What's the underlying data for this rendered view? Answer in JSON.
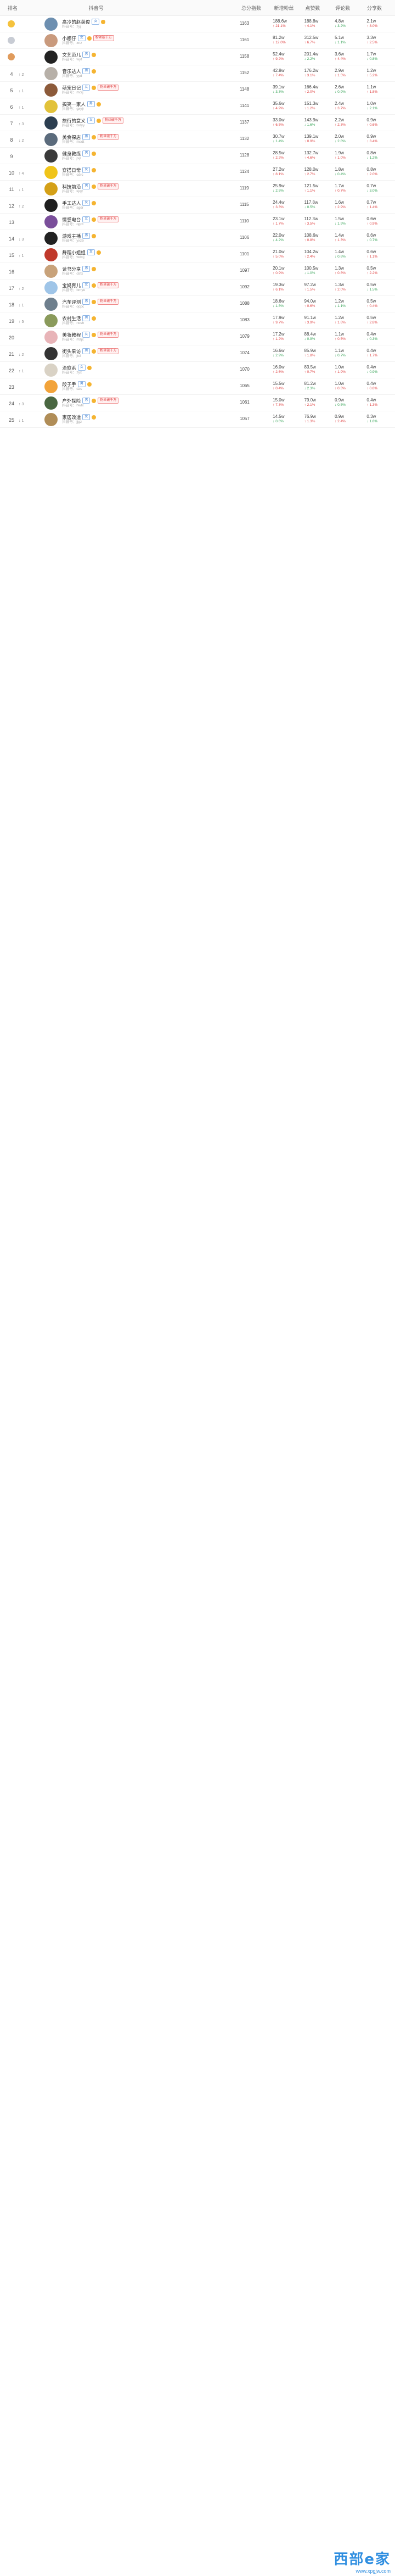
{
  "header": {
    "col_rank": "排名",
    "col_name": "抖音号",
    "col_score": "总分指数",
    "col_m1": "新增粉丝",
    "col_m2": "点赞数",
    "col_m3": "评论数",
    "col_m4": "分享数"
  },
  "colors": {
    "accent": "#e04848",
    "tag_blue": "#3f7fd1",
    "watermark": "#2f8ee0"
  },
  "watermark": {
    "title": "西部e家",
    "url": "www.xpgjw.com"
  },
  "rows": [
    {
      "rank": "1",
      "change": "",
      "name": "高冷的赵英俊",
      "sub": "抖音号：zyj",
      "tag": "女",
      "red": "",
      "score": "1163",
      "m1": "188.6w",
      "m1s": "↑ 21.1%",
      "m2": "188.8w",
      "m2s": "↑ 4.1%",
      "m3": "4.8w",
      "m3s": "↓ 3.2%",
      "m4": "2.1w",
      "m4s": "↑ 8.0%",
      "avatar": "#6d8fb0"
    },
    {
      "rank": "2",
      "change": "",
      "name": "小娜仔",
      "sub": "抖音号：xnz",
      "tag": "女",
      "red": "粉丝破千万",
      "score": "1161",
      "m1": "81.2w",
      "m1s": "↑ 12.0%",
      "m2": "312.5w",
      "m2s": "↑ 6.7%",
      "m3": "5.1w",
      "m3s": "↓ 1.1%",
      "m4": "3.3w",
      "m4s": "↑ 2.5%",
      "avatar": "#c99a7d"
    },
    {
      "rank": "3",
      "change": "",
      "name": "文艺范儿",
      "sub": "抖音号：wyf",
      "tag": "男",
      "red": "",
      "score": "1158",
      "m1": "52.4w",
      "m1s": "↑ 9.2%",
      "m2": "201.4w",
      "m2s": "↓ 2.2%",
      "m3": "3.6w",
      "m3s": "↑ 4.4%",
      "m4": "1.7w",
      "m4s": "↓ 0.8%",
      "avatar": "#222222"
    },
    {
      "rank": "4",
      "change": "↑ 2",
      "name": "音乐达人",
      "sub": "抖音号：yyd",
      "tag": "男",
      "red": "",
      "score": "1152",
      "m1": "42.8w",
      "m1s": "↑ 7.4%",
      "m2": "176.2w",
      "m2s": "↑ 3.1%",
      "m3": "2.9w",
      "m3s": "↑ 1.5%",
      "m4": "1.2w",
      "m4s": "↑ 5.2%",
      "avatar": "#b7b0a8"
    },
    {
      "rank": "5",
      "change": "↓ 1",
      "name": "萌宠日记",
      "sub": "抖音号：mcrj",
      "tag": "女",
      "red": "粉丝破千万",
      "score": "1148",
      "m1": "39.1w",
      "m1s": "↓ 3.3%",
      "m2": "166.4w",
      "m2s": "↑ 2.0%",
      "m3": "2.6w",
      "m3s": "↓ 0.9%",
      "m4": "1.1w",
      "m4s": "↑ 1.8%",
      "avatar": "#8c5a3a"
    },
    {
      "rank": "6",
      "change": "↑ 1",
      "name": "搞笑一家人",
      "sub": "抖音号：gxyjr",
      "tag": "男",
      "red": "",
      "score": "1141",
      "m1": "35.6w",
      "m1s": "↑ 4.9%",
      "m2": "151.3w",
      "m2s": "↑ 1.2%",
      "m3": "2.4w",
      "m3s": "↑ 3.7%",
      "m4": "1.0w",
      "m4s": "↓ 2.1%",
      "avatar": "#e2c23a"
    },
    {
      "rank": "7",
      "change": "↑ 3",
      "name": "旅行的意义",
      "sub": "抖音号：lxdyy",
      "tag": "女",
      "red": "粉丝破千万",
      "score": "1137",
      "m1": "33.0w",
      "m1s": "↑ 6.5%",
      "m2": "143.9w",
      "m2s": "↓ 1.6%",
      "m3": "2.2w",
      "m3s": "↑ 2.3%",
      "m4": "0.9w",
      "m4s": "↑ 0.6%",
      "avatar": "#2c3e50"
    },
    {
      "rank": "8",
      "change": "↓ 2",
      "name": "美食探店",
      "sub": "抖音号：msdt",
      "tag": "男",
      "red": "粉丝破千万",
      "score": "1132",
      "m1": "30.7w",
      "m1s": "↓ 1.4%",
      "m2": "139.1w",
      "m2s": "↑ 0.9%",
      "m3": "2.0w",
      "m3s": "↓ 2.8%",
      "m4": "0.9w",
      "m4s": "↑ 3.4%",
      "avatar": "#5b6b7c"
    },
    {
      "rank": "9",
      "change": "",
      "name": "健身教练",
      "sub": "抖音号：jsjl",
      "tag": "男",
      "red": "",
      "score": "1128",
      "m1": "28.5w",
      "m1s": "↑ 2.2%",
      "m2": "132.7w",
      "m2s": "↑ 4.6%",
      "m3": "1.9w",
      "m3s": "↑ 1.0%",
      "m4": "0.8w",
      "m4s": "↓ 1.2%",
      "avatar": "#3a3a3a"
    },
    {
      "rank": "10",
      "change": "↑ 4",
      "name": "穿搭日常",
      "sub": "抖音号：cdrc",
      "tag": "女",
      "red": "",
      "score": "1124",
      "m1": "27.2w",
      "m1s": "↑ 8.1%",
      "m2": "128.0w",
      "m2s": "↑ 2.7%",
      "m3": "1.8w",
      "m3s": "↓ 0.4%",
      "m4": "0.8w",
      "m4s": "↑ 2.0%",
      "avatar": "#f0c419"
    },
    {
      "rank": "11",
      "change": "↓ 1",
      "name": "科技前沿",
      "sub": "抖音号：kjqy",
      "tag": "男",
      "red": "粉丝破千万",
      "score": "1119",
      "m1": "25.9w",
      "m1s": "↓ 2.5%",
      "m2": "121.5w",
      "m2s": "↑ 1.1%",
      "m3": "1.7w",
      "m3s": "↑ 0.7%",
      "m4": "0.7w",
      "m4s": "↓ 3.0%",
      "avatar": "#d4a017"
    },
    {
      "rank": "12",
      "change": "↑ 2",
      "name": "手工达人",
      "sub": "抖音号：sgdr",
      "tag": "女",
      "red": "",
      "score": "1115",
      "m1": "24.4w",
      "m1s": "↑ 3.3%",
      "m2": "117.8w",
      "m2s": "↓ 0.5%",
      "m3": "1.6w",
      "m3s": "↑ 2.9%",
      "m4": "0.7w",
      "m4s": "↑ 1.4%",
      "avatar": "#1f1f1f"
    },
    {
      "rank": "13",
      "change": "",
      "name": "情感电台",
      "sub": "抖音号：qgdt",
      "tag": "女",
      "red": "粉丝破千万",
      "score": "1110",
      "m1": "23.1w",
      "m1s": "↑ 1.7%",
      "m2": "112.3w",
      "m2s": "↑ 3.5%",
      "m3": "1.5w",
      "m3s": "↓ 1.9%",
      "m4": "0.6w",
      "m4s": "↑ 0.9%",
      "avatar": "#7a4e9a"
    },
    {
      "rank": "14",
      "change": "↓ 3",
      "name": "游戏主播",
      "sub": "抖音号：yxzb",
      "tag": "男",
      "red": "",
      "score": "1106",
      "m1": "22.0w",
      "m1s": "↓ 4.2%",
      "m2": "108.6w",
      "m2s": "↑ 0.8%",
      "m3": "1.4w",
      "m3s": "↑ 1.3%",
      "m4": "0.6w",
      "m4s": "↓ 0.7%",
      "avatar": "#222222"
    },
    {
      "rank": "15",
      "change": "↑ 1",
      "name": "舞蹈小姐姐",
      "sub": "抖音号：wdxjj",
      "tag": "女",
      "red": "",
      "score": "1101",
      "m1": "21.0w",
      "m1s": "↑ 5.0%",
      "m2": "104.2w",
      "m2s": "↑ 2.4%",
      "m3": "1.4w",
      "m3s": "↓ 0.6%",
      "m4": "0.6w",
      "m4s": "↑ 1.1%",
      "avatar": "#c0392b"
    },
    {
      "rank": "16",
      "change": "",
      "name": "读书分享",
      "sub": "抖音号：dsfx",
      "tag": "男",
      "red": "",
      "score": "1097",
      "m1": "20.1w",
      "m1s": "↑ 0.9%",
      "m2": "100.5w",
      "m2s": "↓ 1.0%",
      "m3": "1.3w",
      "m3s": "↑ 0.8%",
      "m4": "0.5w",
      "m4s": "↑ 2.2%",
      "avatar": "#c8a27a"
    },
    {
      "rank": "17",
      "change": "↑ 2",
      "name": "宝妈育儿",
      "sub": "抖音号：bmye",
      "tag": "女",
      "red": "粉丝破千万",
      "score": "1092",
      "m1": "19.3w",
      "m1s": "↑ 6.1%",
      "m2": "97.2w",
      "m2s": "↑ 1.5%",
      "m3": "1.3w",
      "m3s": "↑ 2.0%",
      "m4": "0.5w",
      "m4s": "↓ 1.5%",
      "avatar": "#9fc5e8"
    },
    {
      "rank": "18",
      "change": "↓ 1",
      "name": "汽车评测",
      "sub": "抖音号：qcpc",
      "tag": "男",
      "red": "粉丝破千万",
      "score": "1088",
      "m1": "18.6w",
      "m1s": "↓ 1.8%",
      "m2": "94.0w",
      "m2s": "↑ 0.6%",
      "m3": "1.2w",
      "m3s": "↓ 1.1%",
      "m4": "0.5w",
      "m4s": "↑ 0.4%",
      "avatar": "#6e7f8d"
    },
    {
      "rank": "19",
      "change": "↑ 5",
      "name": "农村生活",
      "sub": "抖音号：ncsh",
      "tag": "男",
      "red": "",
      "score": "1083",
      "m1": "17.9w",
      "m1s": "↑ 9.7%",
      "m2": "91.1w",
      "m2s": "↑ 3.9%",
      "m3": "1.2w",
      "m3s": "↑ 1.6%",
      "m4": "0.5w",
      "m4s": "↑ 2.8%",
      "avatar": "#8a9a5b"
    },
    {
      "rank": "20",
      "change": "",
      "name": "美妆教程",
      "sub": "抖音号：mzjc",
      "tag": "女",
      "red": "粉丝破千万",
      "score": "1079",
      "m1": "17.2w",
      "m1s": "↑ 1.2%",
      "m2": "88.4w",
      "m2s": "↓ 0.9%",
      "m3": "1.1w",
      "m3s": "↑ 0.5%",
      "m4": "0.4w",
      "m4s": "↓ 0.3%",
      "avatar": "#e8b4b8"
    },
    {
      "rank": "21",
      "change": "↓ 2",
      "name": "街头采访",
      "sub": "抖音号：jtcf",
      "tag": "男",
      "red": "粉丝破千万",
      "score": "1074",
      "m1": "16.6w",
      "m1s": "↓ 2.9%",
      "m2": "85.9w",
      "m2s": "↑ 1.8%",
      "m3": "1.1w",
      "m3s": "↓ 0.7%",
      "m4": "0.4w",
      "m4s": "↑ 1.7%",
      "avatar": "#333333"
    },
    {
      "rank": "22",
      "change": "↑ 1",
      "name": "治愈系",
      "sub": "抖音号：zyx",
      "tag": "女",
      "red": "",
      "score": "1070",
      "m1": "16.0w",
      "m1s": "↑ 2.6%",
      "m2": "83.5w",
      "m2s": "↑ 0.7%",
      "m3": "1.0w",
      "m3s": "↑ 1.9%",
      "m4": "0.4w",
      "m4s": "↓ 0.9%",
      "avatar": "#d9d2c5"
    },
    {
      "rank": "23",
      "change": "",
      "name": "段子手",
      "sub": "抖音号：dzs",
      "tag": "男",
      "red": "",
      "score": "1065",
      "m1": "15.5w",
      "m1s": "↑ 0.4%",
      "m2": "81.2w",
      "m2s": "↓ 2.3%",
      "m3": "1.0w",
      "m3s": "↑ 0.3%",
      "m4": "0.4w",
      "m4s": "↑ 0.8%",
      "avatar": "#f2a33a"
    },
    {
      "rank": "24",
      "change": "↑ 3",
      "name": "户外探险",
      "sub": "抖音号：hwtx",
      "tag": "男",
      "red": "粉丝破千万",
      "score": "1061",
      "m1": "15.0w",
      "m1s": "↑ 7.3%",
      "m2": "79.0w",
      "m2s": "↑ 2.1%",
      "m3": "0.9w",
      "m3s": "↓ 0.5%",
      "m4": "0.4w",
      "m4s": "↑ 1.3%",
      "avatar": "#4a6741"
    },
    {
      "rank": "25",
      "change": "↓ 1",
      "name": "家居改造",
      "sub": "抖音号：jjgz",
      "tag": "女",
      "red": "",
      "score": "1057",
      "m1": "14.5w",
      "m1s": "↓ 0.6%",
      "m2": "76.9w",
      "m2s": "↑ 1.3%",
      "m3": "0.9w",
      "m3s": "↑ 2.4%",
      "m4": "0.3w",
      "m4s": "↓ 1.8%",
      "avatar": "#b08d57"
    }
  ]
}
